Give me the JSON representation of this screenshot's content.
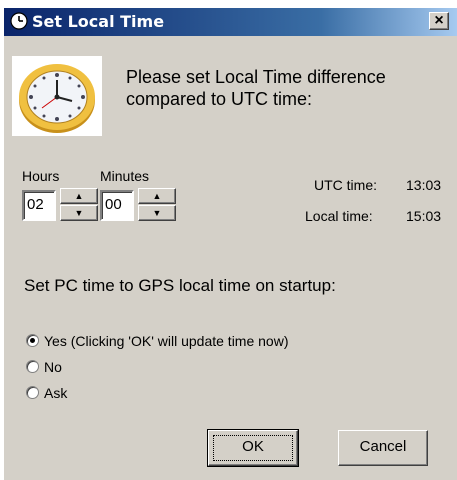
{
  "window": {
    "title": "Set Local Time",
    "close_glyph": "×"
  },
  "icons": {
    "title_icon": "clock-icon",
    "main_icon": "clock-icon"
  },
  "prompt": {
    "line1": "Please set Local Time difference",
    "line2": "compared to UTC time:"
  },
  "offset": {
    "hours_label": "Hours",
    "minutes_label": "Minutes",
    "hours_value": "02",
    "minutes_value": "00",
    "up_glyph": "▲",
    "down_glyph": "▼"
  },
  "times": {
    "utc_label": "UTC time:",
    "utc_value": "13:03",
    "local_label": "Local time:",
    "local_value": "15:03"
  },
  "startup": {
    "label": "Set PC time to GPS local time on startup:",
    "options": [
      {
        "label": "Yes (Clicking 'OK' will update time now)",
        "checked": true
      },
      {
        "label": "No",
        "checked": false
      },
      {
        "label": "Ask",
        "checked": false
      }
    ]
  },
  "buttons": {
    "ok": "OK",
    "cancel": "Cancel"
  },
  "colors": {
    "titlebar": "#0a246a",
    "dialog_bg": "#d4d0c8",
    "clock_gold": "#e8b631"
  }
}
